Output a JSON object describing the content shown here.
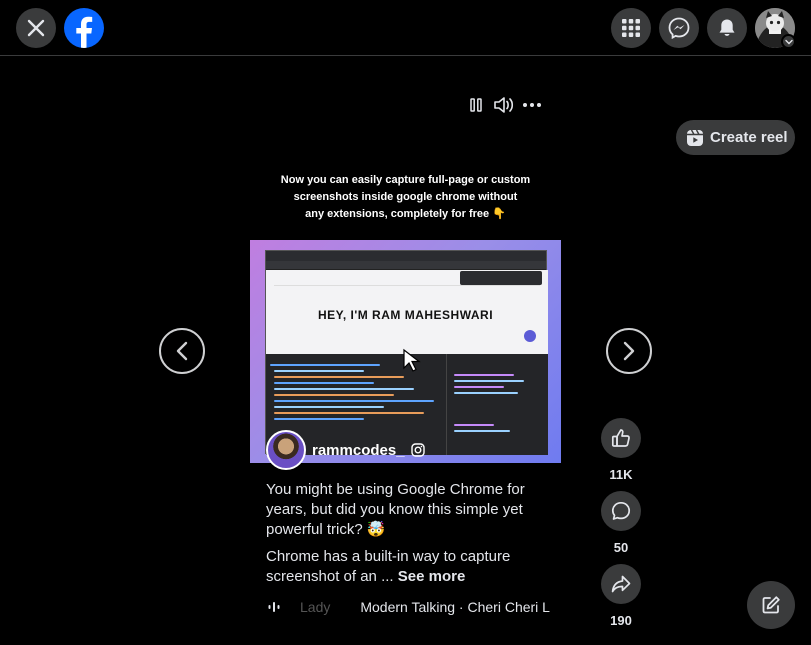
{
  "header": {
    "close_icon": "close-icon",
    "logo_icon": "facebook-logo",
    "menu_icon": "grid-menu-icon",
    "messenger_icon": "messenger-icon",
    "notifications_icon": "bell-icon",
    "profile_icon": "avatar",
    "brand_color": "#0866ff"
  },
  "reel": {
    "create_reel_label": "Create reel",
    "video_caption_line1": "Now you can easily capture full-page or custom",
    "video_caption_line2": "screenshots inside google chrome without",
    "video_caption_line3": "any extensions, completely for free 👇",
    "site_hero_text": "HEY, I'M RAM MAHESHWARI",
    "author_name": "rammcodes_",
    "description_p1": "You might be using Google Chrome for years, but did you know this simple yet powerful trick? 🤯",
    "description_p2": "Chrome has a built-in way to capture screenshot of an ...",
    "see_more_label": "See more",
    "audio_faded": "Lady",
    "audio_track": "Modern Talking · Cheri Cheri L"
  },
  "actions": {
    "likes": "11K",
    "comments": "50",
    "shares": "190"
  }
}
